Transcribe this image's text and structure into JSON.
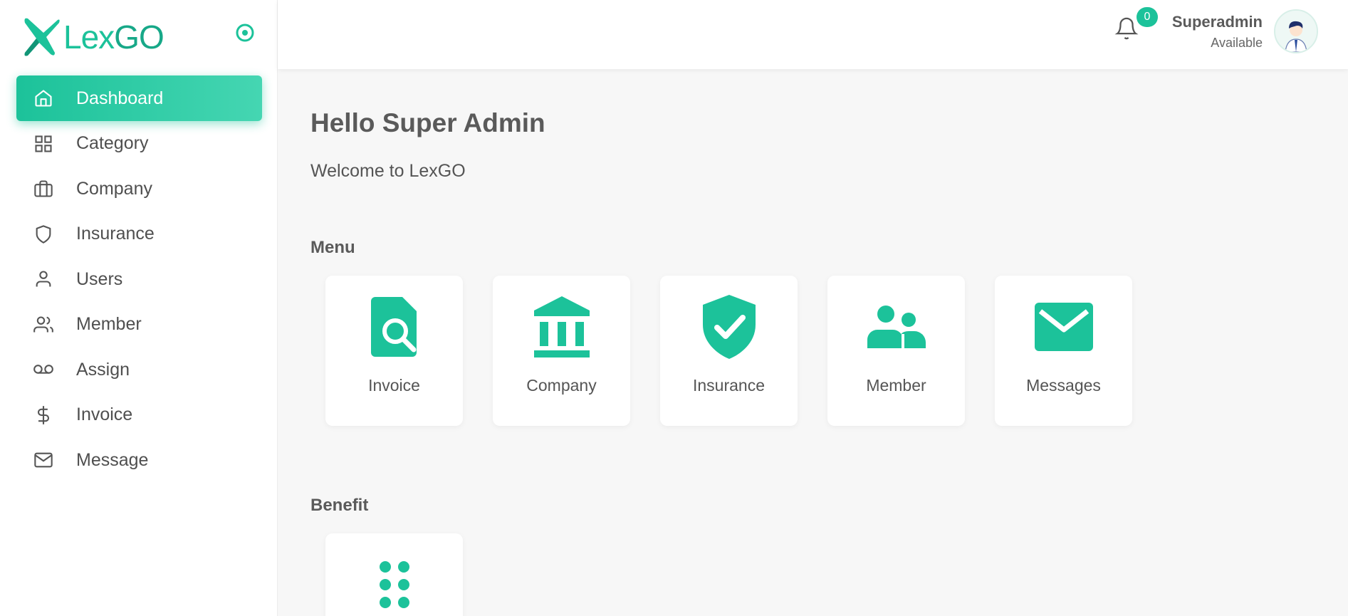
{
  "brand": {
    "logo_text_a": "Lex",
    "logo_text_b": "GO",
    "accent": "#1cc29a"
  },
  "sidebar": {
    "items": [
      {
        "label": "Dashboard",
        "icon": "home-icon",
        "active": true
      },
      {
        "label": "Category",
        "icon": "grid-icon"
      },
      {
        "label": "Company",
        "icon": "briefcase-icon"
      },
      {
        "label": "Insurance",
        "icon": "shield-icon"
      },
      {
        "label": "Users",
        "icon": "user-icon"
      },
      {
        "label": "Member",
        "icon": "users-icon"
      },
      {
        "label": "Assign",
        "icon": "voicemail-icon"
      },
      {
        "label": "Invoice",
        "icon": "dollar-icon"
      },
      {
        "label": "Message",
        "icon": "mail-icon"
      }
    ]
  },
  "header": {
    "notification_count": "0",
    "user_name": "Superadmin",
    "user_status": "Available"
  },
  "main": {
    "greeting": "Hello Super Admin",
    "welcome": "Welcome to LexGO",
    "menu_title": "Menu",
    "menu_cards": [
      {
        "label": "Invoice",
        "icon": "file-search-icon"
      },
      {
        "label": "Company",
        "icon": "bank-icon"
      },
      {
        "label": "Insurance",
        "icon": "shield-check-icon"
      },
      {
        "label": "Member",
        "icon": "people-icon"
      },
      {
        "label": "Messages",
        "icon": "envelope-icon"
      }
    ],
    "benefit_title": "Benefit",
    "benefit_cards": [
      {
        "label": "",
        "icon": "dots-grid-icon"
      }
    ]
  }
}
